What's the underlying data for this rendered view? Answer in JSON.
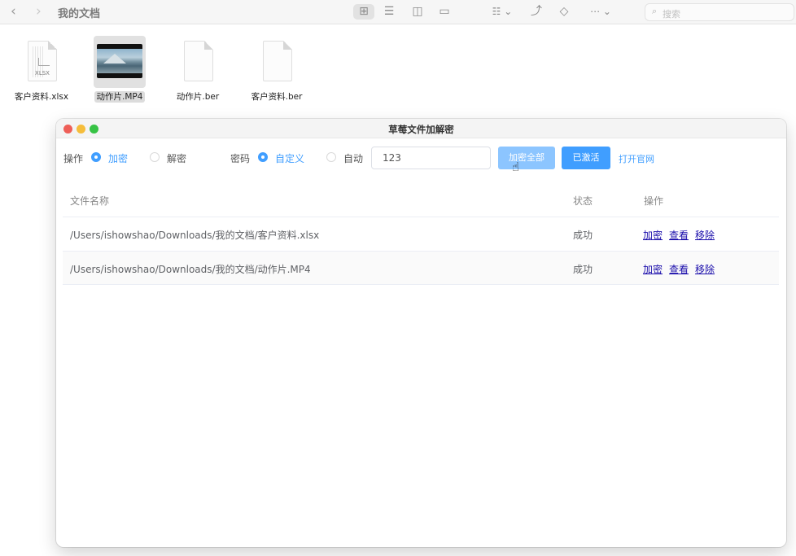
{
  "finder": {
    "title": "我的文档",
    "search_placeholder": "搜索",
    "files": [
      {
        "name": "客户资料.xlsx",
        "type": "xlsx",
        "ext_label": "XLSX",
        "selected": false
      },
      {
        "name": "动作片.MP4",
        "type": "video",
        "selected": true
      },
      {
        "name": "动作片.ber",
        "type": "doc",
        "selected": false
      },
      {
        "name": "客户资料.ber",
        "type": "doc",
        "selected": false
      }
    ]
  },
  "app": {
    "title": "草莓文件加解密",
    "operation_label": "操作",
    "op_encrypt": "加密",
    "op_decrypt": "解密",
    "password_label": "密码",
    "pw_custom": "自定义",
    "pw_auto": "自动",
    "password_value": "123",
    "btn_encrypt_all": "加密全部",
    "btn_activated": "已激活",
    "link_official": "打开官网",
    "table": {
      "col_filename": "文件名称",
      "col_status": "状态",
      "col_actions": "操作",
      "rows": [
        {
          "path": "/Users/ishowshao/Downloads/我的文档/客户资料.xlsx",
          "status": "成功",
          "a1": "加密",
          "a2": "查看",
          "a3": "移除"
        },
        {
          "path": "/Users/ishowshao/Downloads/我的文档/动作片.MP4",
          "status": "成功",
          "a1": "加密",
          "a2": "查看",
          "a3": "移除"
        }
      ]
    }
  },
  "colors": {
    "accent": "#409eff",
    "accent_light": "#8cc5ff",
    "link": "#1a0dab"
  }
}
